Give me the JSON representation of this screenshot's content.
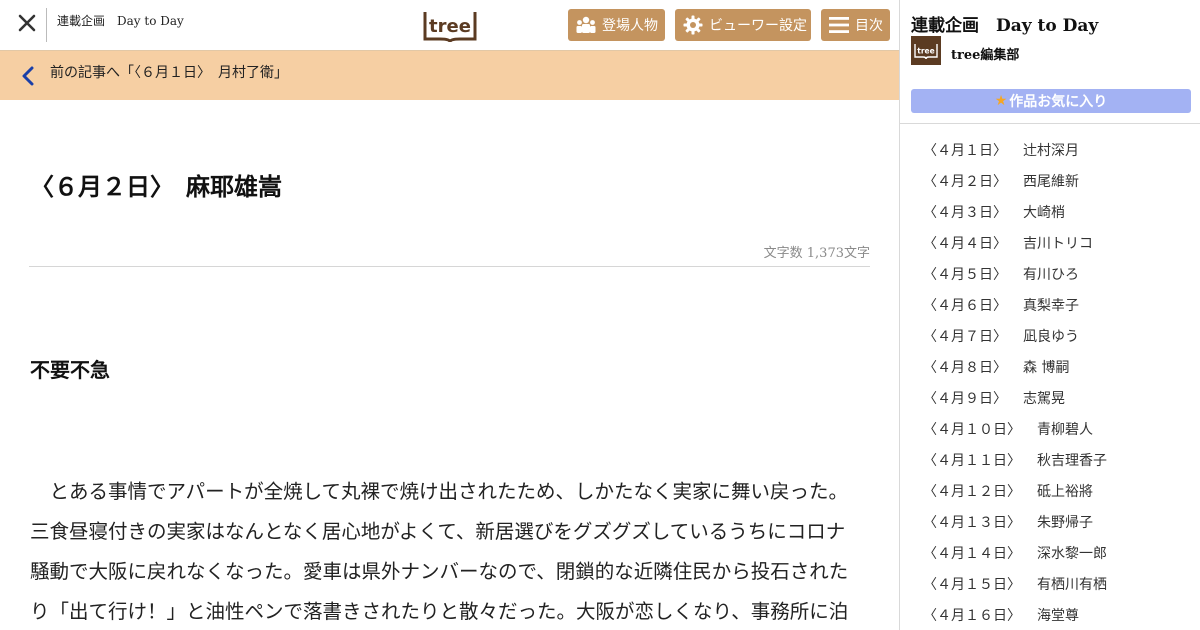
{
  "topbar": {
    "series_title": "連載企画　Day to Day",
    "logo_text": "tree",
    "characters_label": "登場人物",
    "viewer_label": "ビューワー設定",
    "toc_label": "目次"
  },
  "prev": {
    "label": "前の記事へ「〈６月１日〉　月村了衛」"
  },
  "article": {
    "title": "〈６月２日〉　麻耶雄嵩",
    "char_count": "文字数 1,373文字",
    "section_heading": "不要不急",
    "lines": [
      "　とある事情でアパートが全焼して丸裸で焼け出されたため、しかたなく実家に舞い戻った。",
      "三食昼寝付きの実家はなんとなく居心地がよくて、新居選びをグズグズしているうちにコロナ",
      "騒動で大阪に戻れなくなった。愛車は県外ナンバーなので、閉鎖的な近隣住民から投石された",
      "り「出て行け！」と油性ペンで落書きされたりと散々だった。大阪が恋しくなり、事務所に泊"
    ]
  },
  "side": {
    "title": "連載企画　Day to Day",
    "author": "tree編集部",
    "avatar_text": "tree",
    "favorite_label": "作品お気に入り",
    "toc": [
      {
        "date": "〈４月１日〉",
        "author": "辻村深月"
      },
      {
        "date": "〈４月２日〉",
        "author": "西尾維新"
      },
      {
        "date": "〈４月３日〉",
        "author": "大崎梢"
      },
      {
        "date": "〈４月４日〉",
        "author": "吉川トリコ"
      },
      {
        "date": "〈４月５日〉",
        "author": "有川ひろ"
      },
      {
        "date": "〈４月６日〉",
        "author": "真梨幸子"
      },
      {
        "date": "〈４月７日〉",
        "author": "凪良ゆう"
      },
      {
        "date": "〈４月８日〉",
        "author": "森 博嗣"
      },
      {
        "date": "〈４月９日〉",
        "author": "志駕晃"
      },
      {
        "date": "〈４月１０日〉",
        "author": "青柳碧人"
      },
      {
        "date": "〈４月１１日〉",
        "author": "秋吉理香子"
      },
      {
        "date": "〈４月１２日〉",
        "author": "砥上裕將"
      },
      {
        "date": "〈４月１３日〉",
        "author": "朱野帰子"
      },
      {
        "date": "〈４月１４日〉",
        "author": "深水黎一郎"
      },
      {
        "date": "〈４月１５日〉",
        "author": "有栖川有栖"
      },
      {
        "date": "〈４月１６日〉",
        "author": "海堂尊"
      }
    ]
  },
  "colors": {
    "accent_brown": "#c4945f",
    "prev_bar": "#f6cfa3",
    "favorite_blue": "#a3b2f3",
    "logo_brown": "#5b3b22"
  },
  "icons": {
    "close": "close-icon",
    "characters": "people-icon",
    "viewer": "gear-icon",
    "toc": "menu-icon",
    "prev": "chevron-left-icon",
    "favorite": "star-icon"
  }
}
